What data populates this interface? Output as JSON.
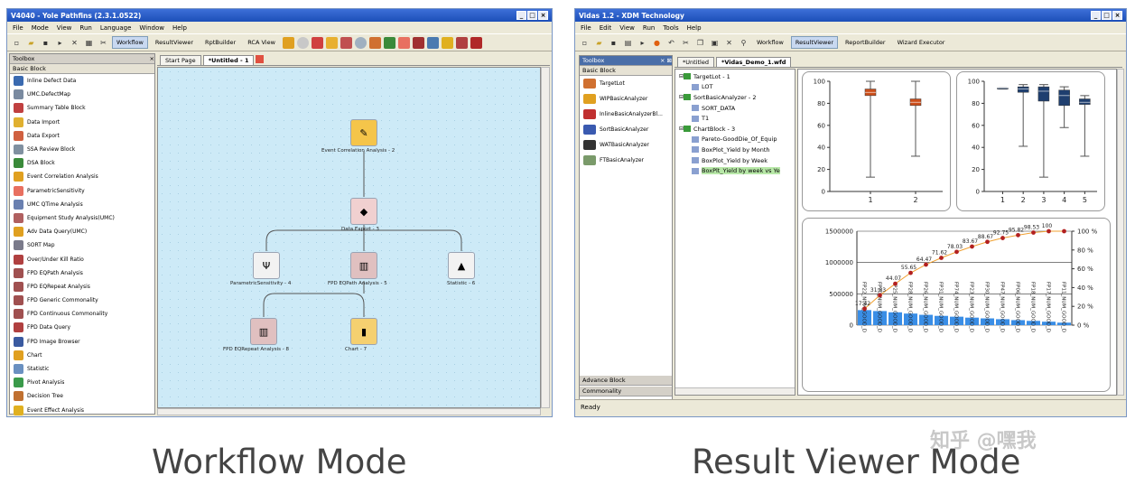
{
  "left": {
    "title": "V4040 - Yole Pathfins (2.3.1.0522)",
    "menu": [
      "File",
      "Mode",
      "View",
      "Run",
      "Language",
      "Window",
      "Help"
    ],
    "modes": [
      "Workflow",
      "ResultViewer",
      "RptBuilder",
      "RCA View"
    ],
    "toolbox_title": "Toolbox",
    "toolbox_section": "Basic Block",
    "toolbox_items": [
      "Inline Defect Data",
      "UMC.DefectMap",
      "Summary Table Block",
      "Data Import",
      "Data Export",
      "SSA Review Block",
      "DSA Block",
      "Event Correlation Analysis",
      "ParametricSensitivity",
      "UMC QTime Analysis",
      "Equipment Study Analysis(UMC)",
      "Adv Data Query(UMC)",
      "SORT Map",
      "Over/Under Kill Ratio",
      "FPD EQPath Analysis",
      "FPD EQRepeat Analysis",
      "FPD Generic Commonality",
      "FPD Continuous Commonality",
      "FPD Data Query",
      "FPD Image Browser",
      "Chart",
      "Statistic",
      "Pivot Analysis",
      "Decision Tree",
      "Event Effect Analysis"
    ],
    "tabs": [
      "Start Page",
      "*Untitled - 1"
    ],
    "nodes": [
      "Event Correlation Analysis - 2",
      "Data Export - 3",
      "ParametricSensitivity - 4",
      "FPD EQPath Analysis - 5",
      "Statistic - 6",
      "FPD EQRepeat Analysis - 8",
      "Chart - 7"
    ]
  },
  "right": {
    "title": "Vidas 1.2 - XDM Technology",
    "menu": [
      "File",
      "Edit",
      "View",
      "Run",
      "Tools",
      "Help"
    ],
    "modes": [
      "Workflow",
      "ResultViewer",
      "ReportBuilder",
      "Wizard Executor"
    ],
    "toolbox_title": "Toolbox",
    "toolbox_section": "Basic Block",
    "toolbox_items": [
      "TargetLot",
      "WIPBasicAnalyzer",
      "InlineBasicAnalyzerBl...",
      "SortBasicAnalyzer",
      "WATBasicAnalyzer",
      "FTBasicAnalyzer"
    ],
    "tabs": [
      "*Untitled",
      "*Vidas_Demo_1.wfd"
    ],
    "tree": [
      "TargetLot - 1",
      "LOT",
      "SortBasicAnalyzer - 2",
      "SORT_DATA",
      "T1",
      "ChartBlock - 3",
      "Pareto-GoodDie_Of_Equip",
      "BoxPlot_Yield by Month",
      "BoxPlot_Yield by Week",
      "BoxPlt_Yield by week vs Ye"
    ],
    "advance_block": "Advance Block",
    "commonality": "Commonality",
    "status": "Ready"
  },
  "chart_data": [
    {
      "type": "box",
      "categories": [
        "1",
        "2"
      ],
      "ylim": [
        0,
        100
      ],
      "yticks": [
        "0",
        "20",
        "40",
        "60",
        "80",
        "100"
      ],
      "boxes": [
        {
          "min": 13,
          "q1": 87,
          "median": 90,
          "q3": 93,
          "max": 100
        },
        {
          "min": 32,
          "q1": 78,
          "median": 81,
          "q3": 84,
          "max": 100
        }
      ],
      "color": "#cc4e1a"
    },
    {
      "type": "box",
      "categories": [
        "1",
        "2",
        "3",
        "4",
        "5"
      ],
      "ylim": [
        0,
        100
      ],
      "yticks": [
        "0",
        "20",
        "40",
        "60",
        "80",
        "100"
      ],
      "boxes": [
        {
          "min": 93,
          "q1": 93,
          "median": 94,
          "q3": 94,
          "max": 94
        },
        {
          "min": 41,
          "q1": 90,
          "median": 93,
          "q3": 95,
          "max": 97
        },
        {
          "min": 13,
          "q1": 82,
          "median": 91,
          "q3": 95,
          "max": 97
        },
        {
          "min": 58,
          "q1": 78,
          "median": 87,
          "q3": 92,
          "max": 95
        },
        {
          "min": 32,
          "q1": 79,
          "median": 81,
          "q3": 84,
          "max": 87
        }
      ],
      "color": "#1f3f6f"
    },
    {
      "type": "pareto",
      "categories": [
        "FP22_NUM_GOOD_D",
        "FP20_NUM_GOOD_D",
        "FP25_NUM_GOOD_D",
        "FP28_NUM_GOOD_D",
        "FP26_NUM_GOOD_D",
        "FP31_NUM_GOOD_D",
        "FP74_NUM_GOOD_D",
        "FP23_NUM_GOOD_D",
        "FP30_NUM_GOOD_D",
        "FP47_NUM_GOOD_D",
        "FP06_NUM_GOOD_D",
        "FP18_NUM_GOOD_D",
        "FP17_NUM_GOOD_D",
        "FP11_NUM_GOOD_D"
      ],
      "values": [
        240000,
        225000,
        205000,
        185000,
        165000,
        148000,
        135000,
        120000,
        108000,
        95000,
        80000,
        68000,
        55000,
        40000
      ],
      "cumulative": [
        17.42,
        31.83,
        44.07,
        55.65,
        64.47,
        71.62,
        78.03,
        83.67,
        88.67,
        92.75,
        95.82,
        98.53,
        100,
        100
      ],
      "labels": [
        "17.42",
        "31.83",
        "44.07",
        "55.65",
        "64.47",
        "71.62",
        "78.03",
        "83.67",
        "88.67",
        "92.75",
        "95.82",
        "98.53",
        "100"
      ],
      "ylim": [
        0,
        1500000
      ],
      "yticks": [
        "0",
        "500000",
        "1000000",
        "1500000"
      ],
      "y2ticks": [
        "0 %",
        "20 %",
        "40 %",
        "60 %",
        "80 %",
        "100 %"
      ]
    }
  ],
  "captions": {
    "left": "Workflow Mode",
    "right": "Result Viewer Mode"
  },
  "watermark": "知乎 @嘿我"
}
